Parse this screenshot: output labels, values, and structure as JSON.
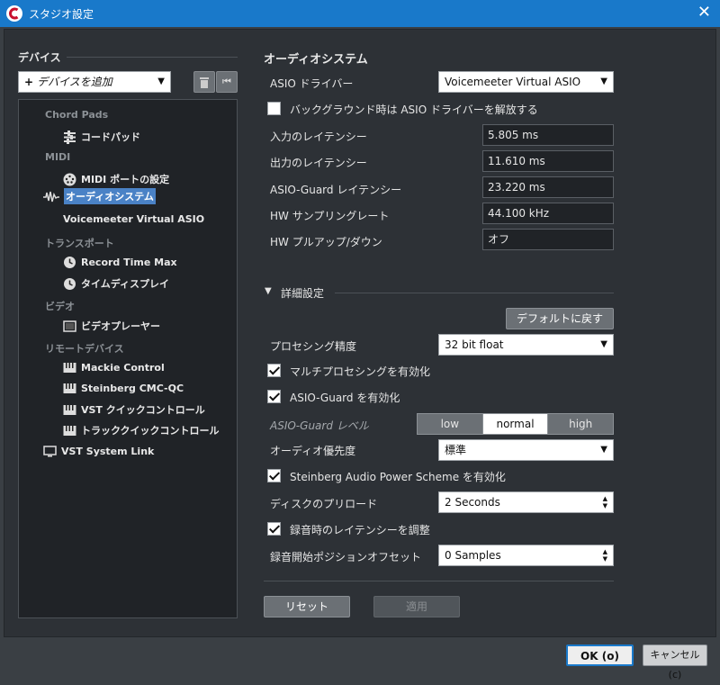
{
  "window": {
    "title": "スタジオ設定",
    "close_glyph": "✕"
  },
  "devices": {
    "header": "デバイス",
    "add_device": "デバイスを追加",
    "tree": {
      "cat_chord": "Chord Pads",
      "chord_pad": "コードパッド",
      "cat_midi": "MIDI",
      "midi_port": "MIDI ポートの設定",
      "audio_system": "オーディオシステム",
      "voicemeeter": "Voicemeeter Virtual ASIO",
      "cat_transport": "トランスポート",
      "record_time": "Record Time Max",
      "time_display": "タイムディスプレイ",
      "cat_video": "ビデオ",
      "video_player": "ビデオプレーヤー",
      "cat_remote": "リモートデバイス",
      "mackie": "Mackie Control",
      "cmc": "Steinberg CMC-QC",
      "vst_quick": "VST クイックコントロール",
      "track_quick": "トラッククイックコントロール",
      "vst_link": "VST System Link"
    }
  },
  "audio": {
    "header": "オーディオシステム",
    "asio_driver_label": "ASIO ドライバー",
    "asio_driver_value": "Voicemeeter Virtual ASIO",
    "release_bg_label": "バックグラウンド時は ASIO ドライバーを解放する",
    "input_latency_label": "入力のレイテンシー",
    "input_latency": "5.805 ms",
    "output_latency_label": "出力のレイテンシー",
    "output_latency": "11.610 ms",
    "guard_latency_label": "ASIO-Guard レイテンシー",
    "guard_latency": "23.220 ms",
    "hw_rate_label": "HW サンプリングレート",
    "hw_rate": "44.100 kHz",
    "hw_pull_label": "HW プルアップ/ダウン",
    "hw_pull": "オフ"
  },
  "advanced": {
    "header": "詳細設定",
    "toggle_glyph": "▼",
    "reset_default": "デフォルトに戻す",
    "precision_label": "プロセシング精度",
    "precision_value": "32 bit float",
    "multi_label": "マルチプロセシングを有効化",
    "guard_enable_label": "ASIO-Guard を有効化",
    "guard_level_label": "ASIO-Guard レベル",
    "guard_levels": [
      "low",
      "normal",
      "high"
    ],
    "priority_label": "オーディオ優先度",
    "priority_value": "標準",
    "power_scheme_label": "Steinberg Audio Power Scheme を有効化",
    "preload_label": "ディスクのプリロード",
    "preload_value": "2 Seconds",
    "adjust_latency_label": "録音時のレイテンシーを調整",
    "offset_label": "録音開始ポジションオフセット",
    "offset_value": "0 Samples"
  },
  "buttons": {
    "reset": "リセット",
    "apply": "適用",
    "ok": "OK (o)",
    "cancel": "キャンセル (c)"
  },
  "colors": {
    "titlebar": "#1979ca",
    "selection": "#4a82c6",
    "panel": "#2d3136"
  }
}
